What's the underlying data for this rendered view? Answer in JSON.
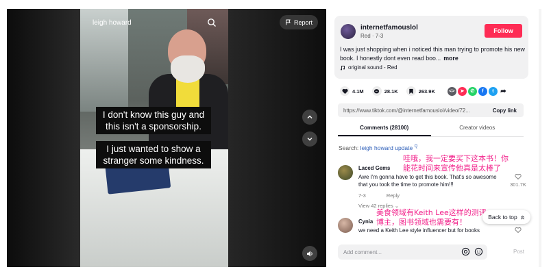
{
  "video": {
    "username_overlay": "leigh howard",
    "report_label": "Report",
    "captions": [
      "I don't know this guy and this isn't a sponsorship.",
      "I just wanted to show a stranger some kindness."
    ]
  },
  "post": {
    "author": "internetfamouslol",
    "subline": "Red · 7-3",
    "follow_label": "Follow",
    "description": "I was just shopping when i noticed this man trying to promote his new book. I honestly dont even read boo...",
    "more_label": "more",
    "sound": "original sound - Red"
  },
  "stats": {
    "likes": "4.1M",
    "comments": "28.1K",
    "saves": "263.9K"
  },
  "share": {
    "url": "https://www.tiktok.com/@internetfamouslol/video/72...",
    "copy_label": "Copy link"
  },
  "tabs": [
    {
      "label": "Comments (28100)",
      "active": true
    },
    {
      "label": "Creator videos",
      "active": false
    }
  ],
  "search": {
    "prefix": "Search:",
    "keyword": "leigh howard update"
  },
  "comments": [
    {
      "name": "Laced Gems",
      "text": "Awe I'm gonna have to get this book. That's so awesome that you took the time to promote him!!!",
      "date": "7-3",
      "reply_label": "Reply",
      "likes": "301.7K",
      "view_replies": "View 42 replies"
    },
    {
      "name": "Cynia",
      "text": "we need a Keith Lee style influencer but for books",
      "likes": ""
    }
  ],
  "overlays": {
    "zh1": "哇哦，我一定要买下这本书！你能花时间来宣传他真是太棒了",
    "zh2": "美食领域有Keith Lee这样的测评博主，图书领域也需要有！"
  },
  "back_to_top": "Back to top",
  "add_comment": {
    "placeholder": "Add comment...",
    "post_label": "Post"
  },
  "colors": {
    "accent": "#fe2c55",
    "keyword": "#2b5db8",
    "overlay_text": "#f2208a"
  }
}
